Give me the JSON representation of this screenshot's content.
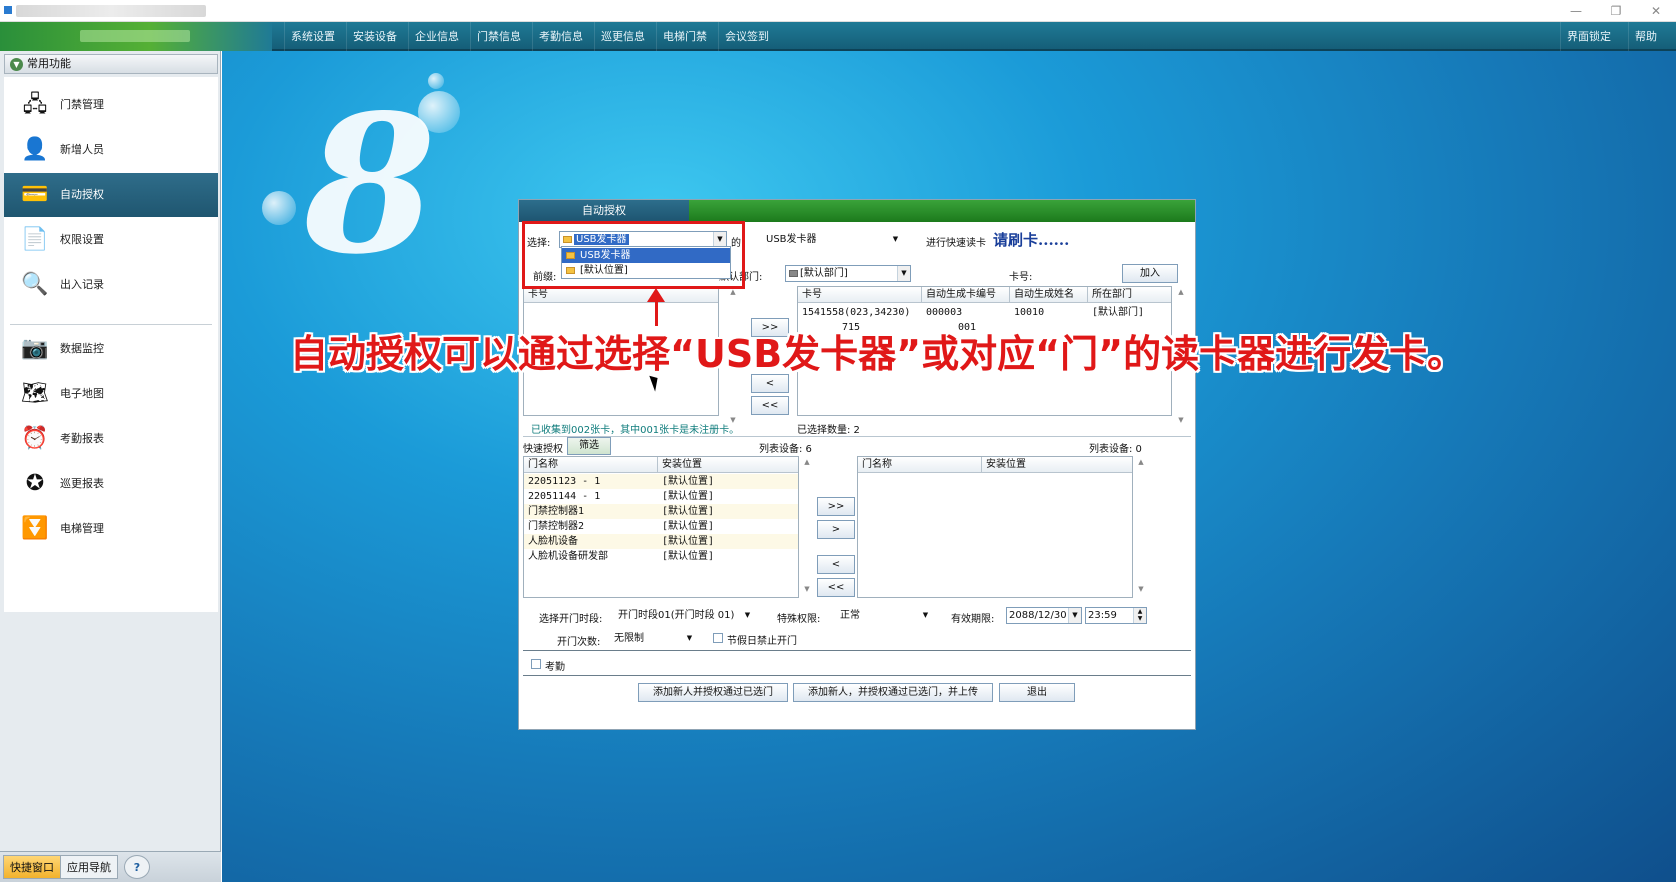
{
  "menubar": {
    "items": [
      "系统设置",
      "安装设备",
      "企业信息",
      "门禁信息",
      "考勤信息",
      "巡更信息",
      "电梯门禁",
      "会议签到"
    ],
    "right_items": [
      "界面锁定",
      "帮助"
    ]
  },
  "sidebar": {
    "header": "常用功能",
    "items": [
      {
        "label": "门禁管理",
        "icon": "network-devices-icon"
      },
      {
        "label": "新增人员",
        "icon": "person-icon"
      },
      {
        "label": "自动授权",
        "icon": "card-icon"
      },
      {
        "label": "权限设置",
        "icon": "permission-doc-icon"
      },
      {
        "label": "出入记录",
        "icon": "magnifier-icon"
      },
      {
        "label": "数据监控",
        "icon": "camera-icon"
      },
      {
        "label": "电子地图",
        "icon": "map-icon"
      },
      {
        "label": "考勤报表",
        "icon": "clock-icon"
      },
      {
        "label": "巡更报表",
        "icon": "patrol-icon"
      },
      {
        "label": "电梯管理",
        "icon": "elevator-icon"
      }
    ],
    "active_index": 2,
    "bottom_tabs": [
      "快捷窗口",
      "应用导航",
      "?"
    ]
  },
  "dialog": {
    "tab": "自动授权",
    "select_label": "选择:",
    "select_value": "USB发卡器",
    "dropdown_options": [
      "USB发卡器",
      "[默认位置]"
    ],
    "of_label": "的",
    "reader_value": "USB发卡器",
    "quick_read_label": "进行快速读卡",
    "swipe_prompt": "请刷卡......",
    "prefix_label": "前缀:",
    "dept_label": "默认部门:",
    "dept_value": "[默认部门]",
    "card_no_label": "卡号:",
    "add_button": "加入",
    "left_list_header": "卡号",
    "right_list_headers": [
      "卡号",
      "自动生成卡编号",
      "自动生成姓名",
      "所在部门"
    ],
    "right_list_rows": [
      [
        "1541558(023,34230)",
        "000003",
        "10010",
        "[默认部门]"
      ],
      [
        "715",
        "001",
        "",
        " "
      ]
    ],
    "transfer_buttons": [
      ">>",
      "<",
      "<<"
    ],
    "collected_status": "已收集到002张卡，其中001张卡是未注册卡。",
    "selected_count": "已选择数量: 2",
    "quick_auth_label": "快速授权",
    "filter_button": "筛选",
    "left_device_count": "列表设备: 6",
    "right_device_count": "列表设备: 0",
    "door_headers": [
      "门名称",
      "安装位置"
    ],
    "doors": [
      [
        "22051123 - 1",
        "[默认位置]"
      ],
      [
        "22051144 - 1",
        "[默认位置]"
      ],
      [
        "门禁控制器1",
        "[默认位置]"
      ],
      [
        "门禁控制器2",
        "[默认位置]"
      ],
      [
        "人脸机设备",
        "[默认位置]"
      ],
      [
        "人脸机设备研发部",
        "[默认位置]"
      ]
    ],
    "door_transfer_buttons": [
      ">>",
      ">",
      "<",
      "<<"
    ],
    "period_label": "选择开门时段:",
    "period_value": "开门时段01(开门时段 01)",
    "special_label": "特殊权限:",
    "special_value": "正常",
    "expiry_label": "有效期限:",
    "expiry_date": "2088/12/30",
    "expiry_time": "23:59",
    "open_count_label": "开门次数:",
    "open_count_value": "无限制",
    "holiday_label": "节假日禁止开门",
    "attendance_label": "考勤",
    "btn_add_auth": "添加新人并授权通过已选门",
    "btn_add_auth_upload": "添加新人，并授权通过已选门，并上传",
    "btn_exit": "退出"
  },
  "caption": "自动授权可以通过选择“USB发卡器”或对应“门”的读卡器进行发卡。",
  "colors": {
    "annotation_red": "#e01818",
    "menubar": "#1a6f8c",
    "active_item": "#245f7c"
  }
}
